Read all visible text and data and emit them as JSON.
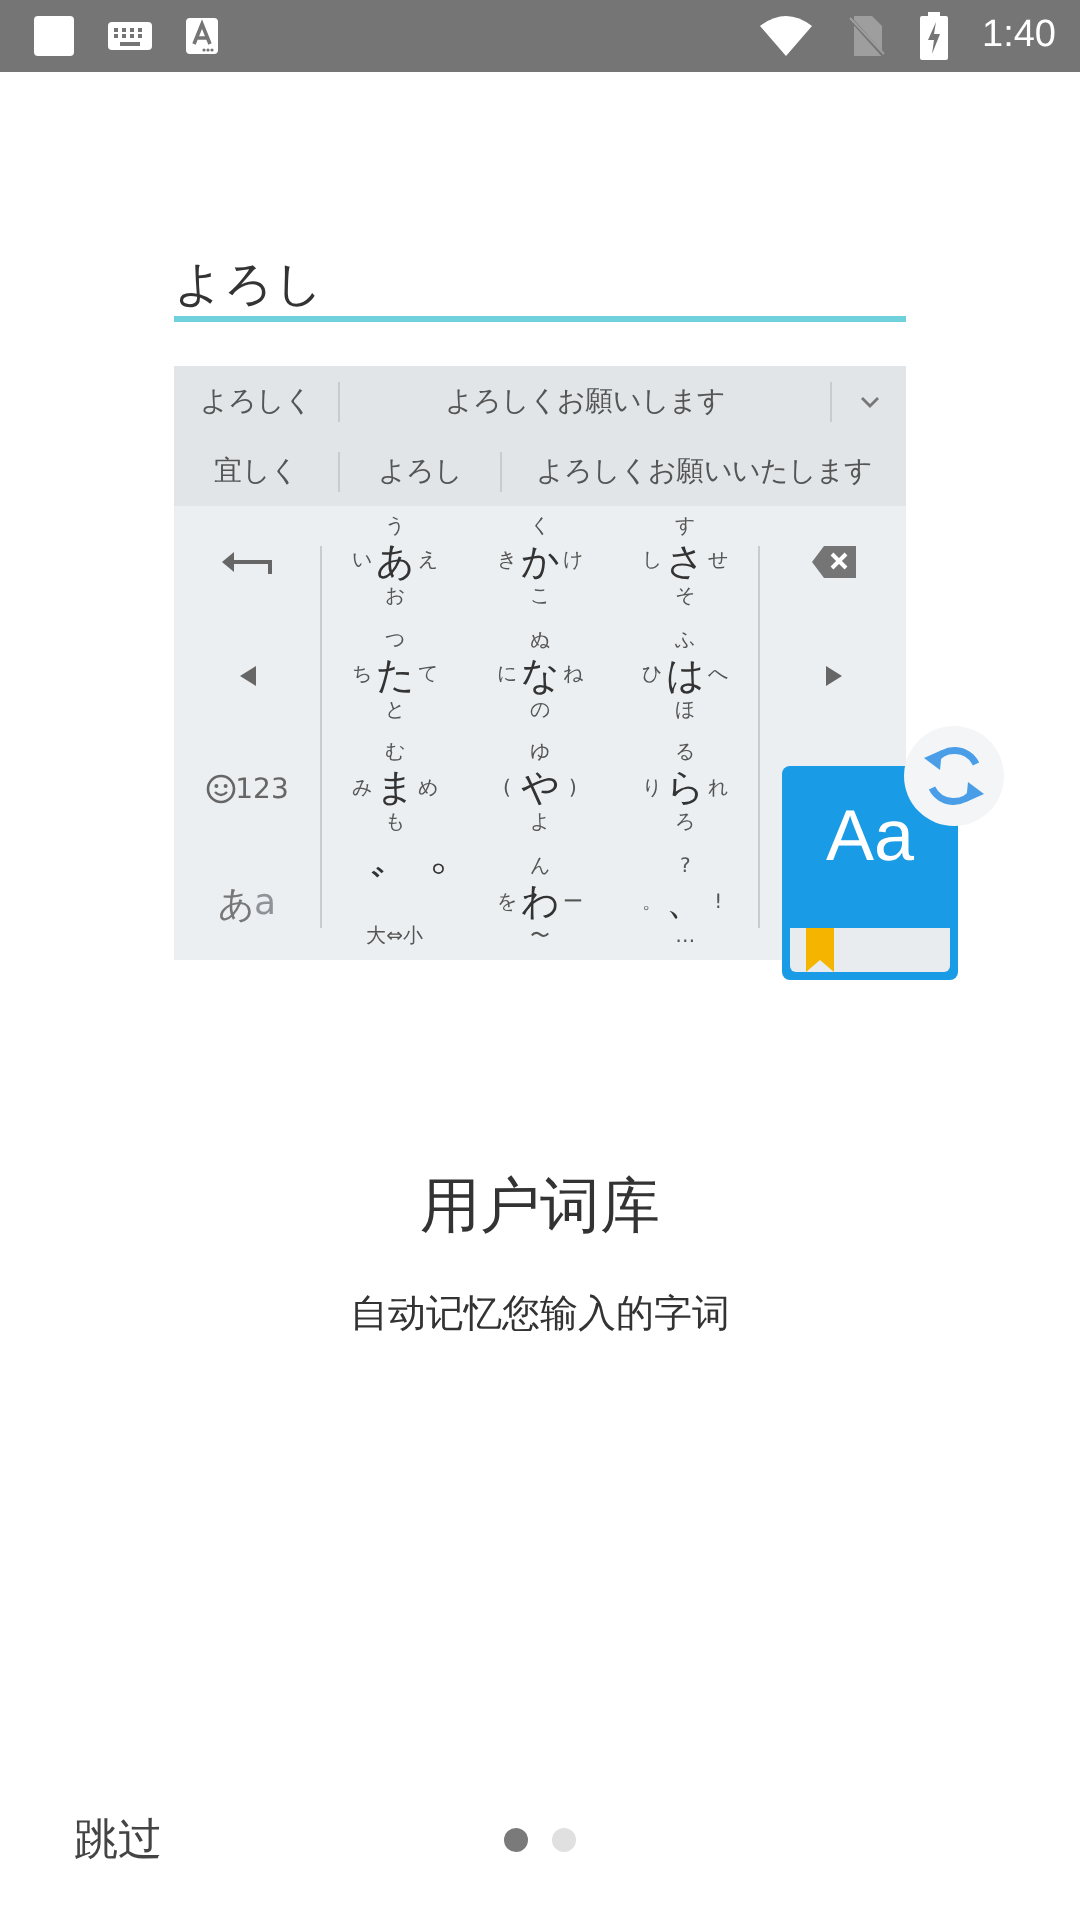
{
  "status_bar": {
    "time": "1:40"
  },
  "illustration": {
    "input_text": "よろし",
    "candidate_rows": [
      [
        "よろしく",
        "よろしくお願いします"
      ],
      [
        "宜しく",
        "よろし",
        "よろしくお願いいたします"
      ]
    ],
    "keys": [
      {
        "up": "う",
        "left": "い",
        "main": "あ",
        "right": "え",
        "down": "お"
      },
      {
        "up": "く",
        "left": "き",
        "main": "か",
        "right": "け",
        "down": "こ"
      },
      {
        "up": "す",
        "left": "し",
        "main": "さ",
        "right": "せ",
        "down": "そ"
      },
      {
        "up": "つ",
        "left": "ち",
        "main": "た",
        "right": "て",
        "down": "と"
      },
      {
        "up": "ぬ",
        "left": "に",
        "main": "な",
        "right": "ね",
        "down": "の"
      },
      {
        "up": "ふ",
        "left": "ひ",
        "main": "は",
        "right": "へ",
        "down": "ほ"
      },
      {
        "up": "む",
        "left": "み",
        "main": "ま",
        "right": "め",
        "down": "も"
      },
      {
        "up": "ゆ",
        "left": "(",
        "main": "や",
        "right": ")",
        "down": "よ"
      },
      {
        "up": "る",
        "left": "り",
        "main": "ら",
        "right": "れ",
        "down": "ろ"
      },
      {
        "main": "゛゜",
        "down": "大⇔小"
      },
      {
        "up": "ん",
        "left": "を",
        "main": "わ",
        "right": "ー",
        "down": "〜"
      },
      {
        "up": "?",
        "left": "。",
        "main": "、",
        "right": "!",
        "down": "…"
      }
    ],
    "mode_key": {
      "numbers": "123",
      "kana": "あ",
      "latin": "a"
    },
    "badge_text": "Aa"
  },
  "title": "用户词库",
  "subtitle": "自动记忆您输入的字词",
  "skip_button": "跳过",
  "pager": [
    {
      "selected": true
    },
    {
      "selected": false
    }
  ]
}
